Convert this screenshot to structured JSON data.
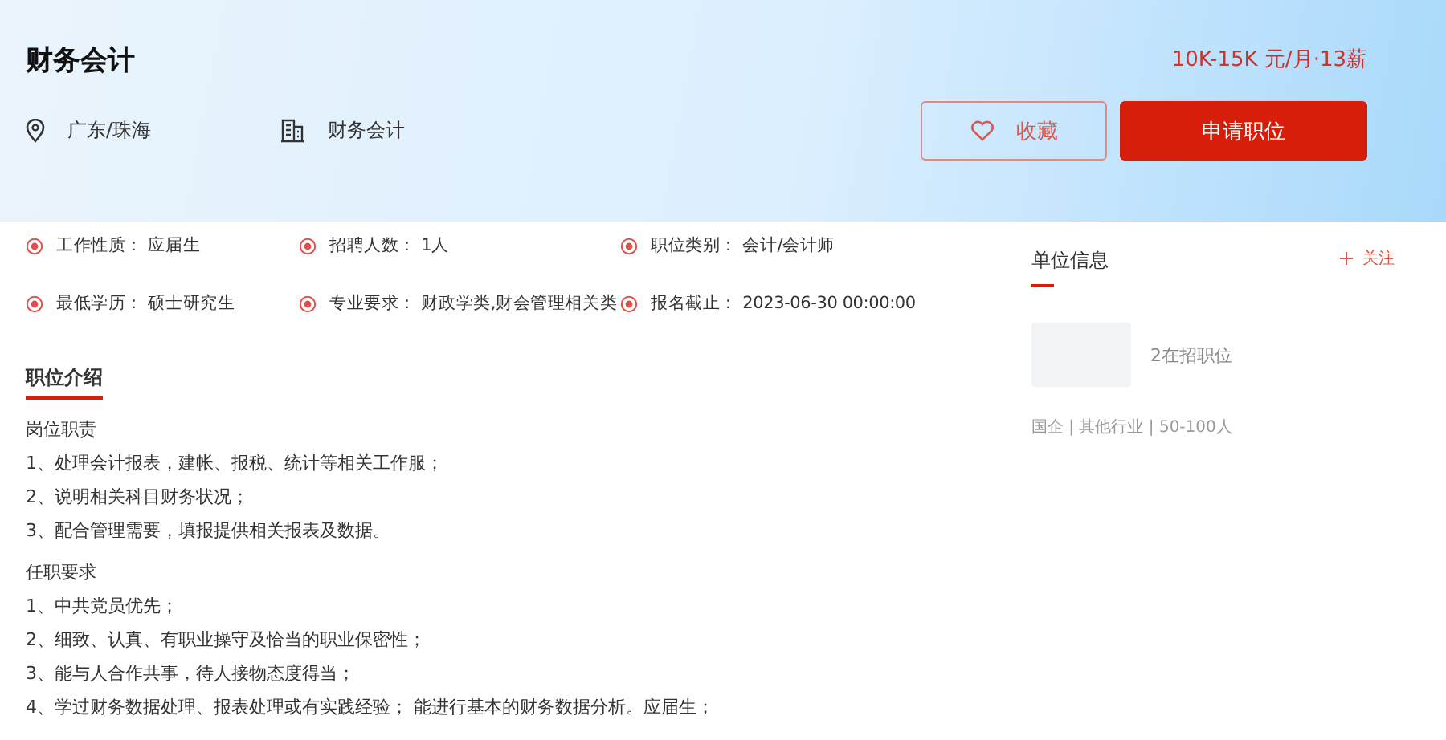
{
  "job": {
    "title": "财务会计",
    "salary": "10K-15K 元/月·13薪",
    "location": "广东/珠海",
    "category": "财务会计"
  },
  "buttons": [
    {
      "kind": "outline",
      "label": "收藏"
    },
    {
      "kind": "primary",
      "label": "申请职位"
    }
  ],
  "facts": [
    {
      "label": "工作性质：",
      "value": "应届生"
    },
    {
      "label": "招聘人数：",
      "value": "1人"
    },
    {
      "label": "职位类别：",
      "value": "会计/会计师"
    },
    {
      "label": "最低学历：",
      "value": "硕士研究生"
    },
    {
      "label": "专业要求：",
      "value": "财政学类,财会管理相关类"
    },
    {
      "label": "报名截止：",
      "value": "2023-06-30 00:00:00"
    }
  ],
  "tabs": [
    {
      "label": "职位介绍",
      "selected": true
    }
  ],
  "sections": [
    {
      "heading": "岗位职责",
      "items": [
        "1、处理会计报表，建帐、报税、统计等相关工作服；",
        "2、说明相关科目财务状况；",
        "3、配合管理需要，填报提供相关报表及数据。"
      ]
    },
    {
      "heading": "任职要求",
      "items": [
        "1、中共党员优先；",
        "2、细致、认真、有职业操守及恰当的职业保密性；",
        "3、能与人合作共事，待人接物态度得当；",
        "4、学过财务数据处理、报表处理或有实践经验； 能进行基本的财务数据分析。应届生；"
      ]
    }
  ],
  "company": {
    "heading": "单位信息",
    "follow": "关注",
    "openings": "2在招职位",
    "meta": "国企 | 其他行业 | 50-100人"
  }
}
